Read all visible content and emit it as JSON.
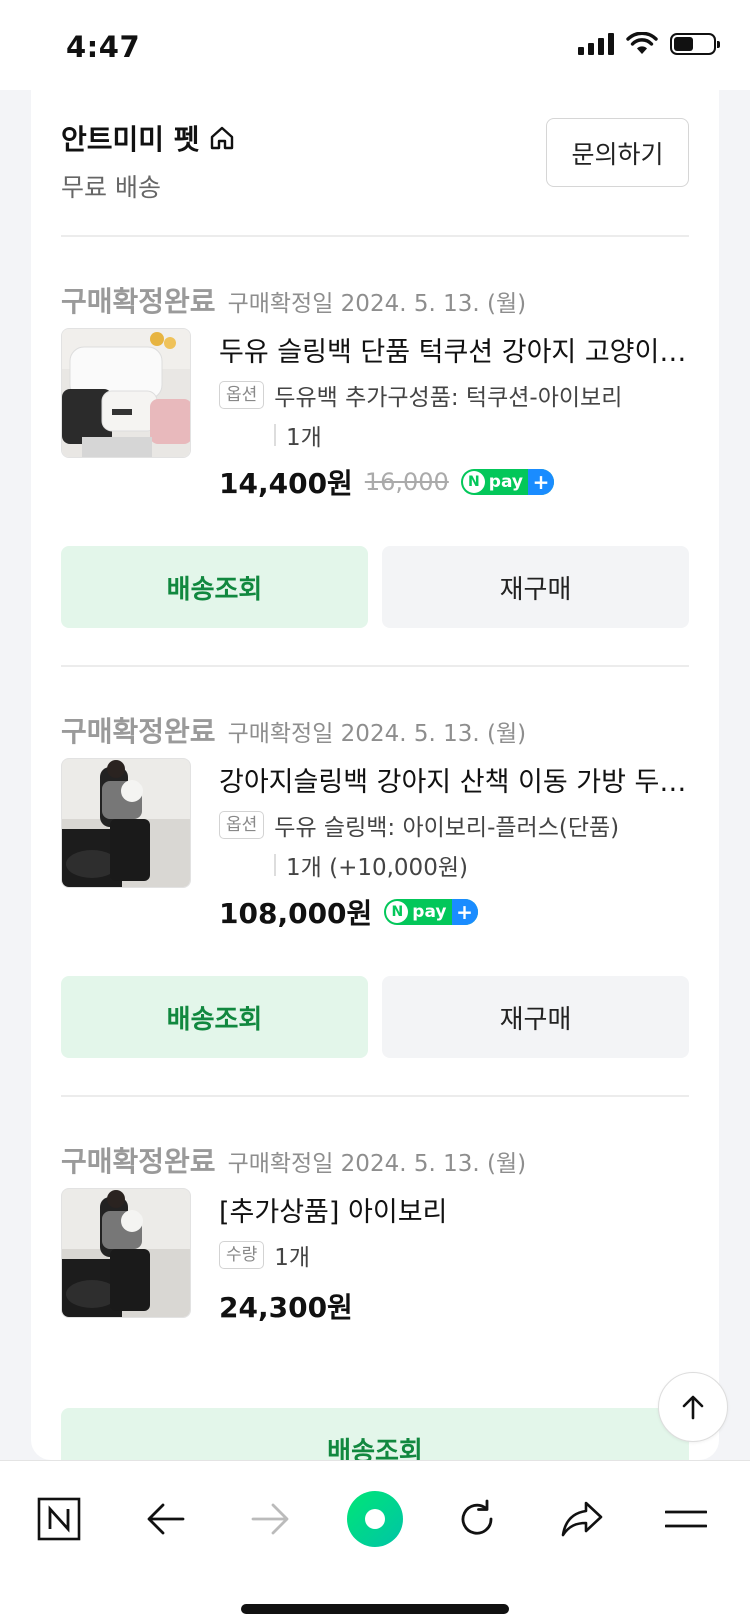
{
  "status_bar": {
    "time": "4:47"
  },
  "store": {
    "name": "안트미미 펫",
    "shipping": "무료 배송",
    "inquiry_label": "문의하기"
  },
  "orders": [
    {
      "status": "구매확정완료",
      "date": "구매확정일 2024. 5. 13. (월)",
      "title": "두유 슬링백 단품 턱쿠션 강아지 고양이 애견 슬링백 이동 가방",
      "option_badge": "옵션",
      "option_text": "두유백 추가구성품: 턱쿠션-아이보리",
      "quantity": "1개",
      "price": "14,400원",
      "original_price": "16,000",
      "npay": true,
      "track_label": "배송조회",
      "rebuy_label": "재구매"
    },
    {
      "status": "구매확정완료",
      "date": "구매확정일 2024. 5. 13. (월)",
      "title": "강아지슬링백 강아지 산책 이동 가방 두유 슬링백",
      "option_badge": "옵션",
      "option_text": "두유 슬링백: 아이보리-플러스(단품)",
      "quantity": "1개 (+10,000원)",
      "price": "108,000원",
      "npay": true,
      "track_label": "배송조회",
      "rebuy_label": "재구매"
    },
    {
      "status": "구매확정완료",
      "date": "구매확정일 2024. 5. 13. (월)",
      "title": "[추가상품] 아이보리",
      "option_badge": "수량",
      "option_text": "1개",
      "price": "24,300원",
      "track_label": "배송조회"
    }
  ],
  "npay_label": "pay",
  "colors": {
    "accent_green": "#03c75a",
    "track_button_bg": "#e3f6ea",
    "track_button_text": "#11883f",
    "npay_plus": "#1a8cff"
  }
}
